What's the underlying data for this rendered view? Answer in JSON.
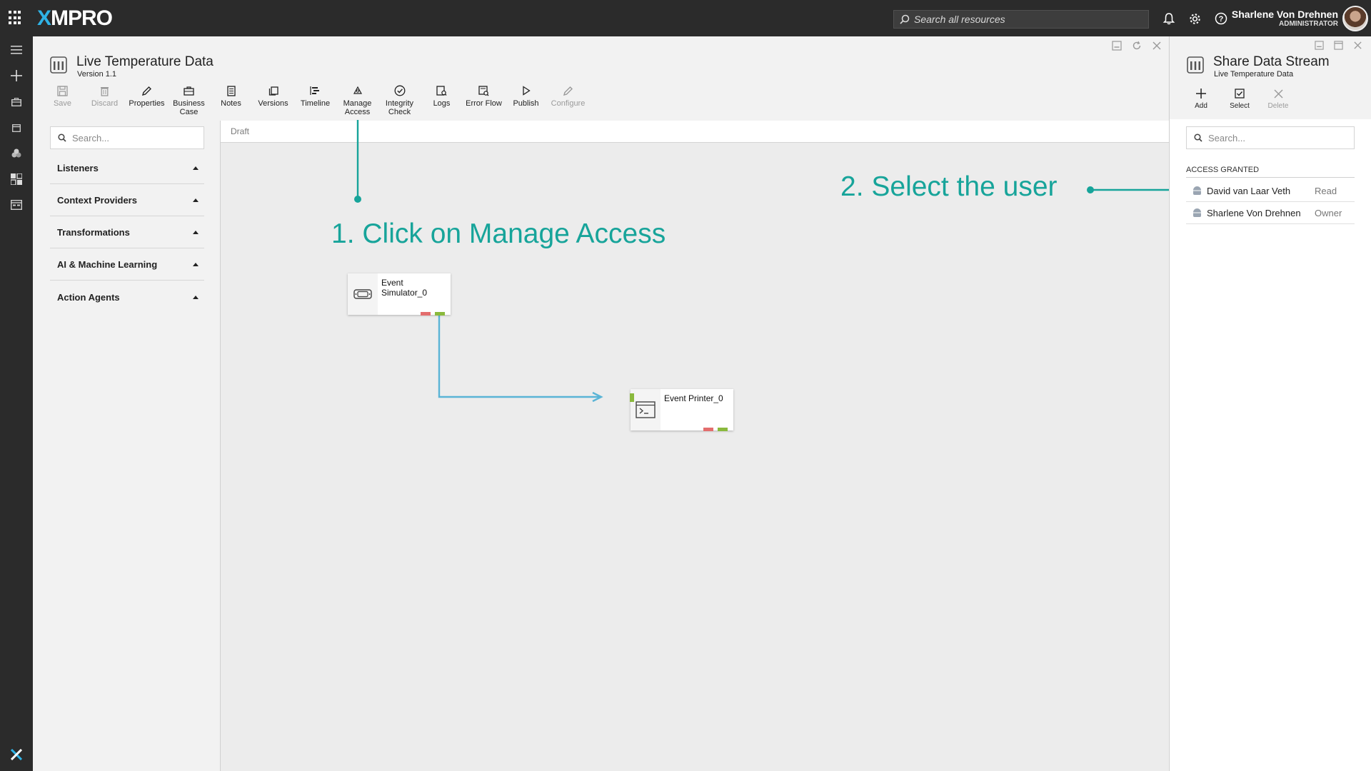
{
  "app": {
    "logo_prefix": "X",
    "logo_rest": "MPRO",
    "search_placeholder": "Search all resources",
    "user_name": "Sharlene Von Drehnen",
    "user_role": "ADMINISTRATOR"
  },
  "stream": {
    "title": "Live Temperature Data",
    "version": "Version 1.1",
    "status_tab": "Draft"
  },
  "toolbar": [
    {
      "label": "Save",
      "icon": "save-icon",
      "enabled": false
    },
    {
      "label": "Discard",
      "icon": "trash-icon",
      "enabled": false
    },
    {
      "label": "Properties",
      "icon": "pencil-icon",
      "enabled": true
    },
    {
      "label": "Business Case",
      "icon": "briefcase-icon",
      "enabled": true
    },
    {
      "label": "Notes",
      "icon": "notes-icon",
      "enabled": true
    },
    {
      "label": "Versions",
      "icon": "versions-icon",
      "enabled": true
    },
    {
      "label": "Timeline",
      "icon": "timeline-icon",
      "enabled": true
    },
    {
      "label": "Manage Access",
      "icon": "access-icon",
      "enabled": true
    },
    {
      "label": "Integrity Check",
      "icon": "check-circle-icon",
      "enabled": true
    },
    {
      "label": "Logs",
      "icon": "logs-icon",
      "enabled": true
    },
    {
      "label": "Error Flow",
      "icon": "error-flow-icon",
      "enabled": true
    },
    {
      "label": "Publish",
      "icon": "play-icon",
      "enabled": true
    },
    {
      "label": "Configure",
      "icon": "pencil-icon",
      "enabled": false
    }
  ],
  "sidebar": {
    "search_placeholder": "Search...",
    "categories": [
      "Listeners",
      "Context Providers",
      "Transformations",
      "AI & Machine Learning",
      "Action Agents"
    ]
  },
  "canvas": {
    "nodes": [
      {
        "label": "Event Simulator_0",
        "icon": "simulator-icon"
      },
      {
        "label": "Event Printer_0",
        "icon": "terminal-icon"
      }
    ]
  },
  "annotations": {
    "step1": "1. Click on Manage Access",
    "step2": "2. Select the user",
    "color": "#17a49a"
  },
  "share_panel": {
    "title": "Share Data Stream",
    "subtitle": "Live Temperature Data",
    "tools": [
      {
        "label": "Add",
        "icon": "plus-icon",
        "enabled": true
      },
      {
        "label": "Select",
        "icon": "checkbox-icon",
        "enabled": true
      },
      {
        "label": "Delete",
        "icon": "close-icon",
        "enabled": false
      }
    ],
    "search_placeholder": "Search...",
    "section_label": "ACCESS GRANTED",
    "users": [
      {
        "name": "David van Laar Veth",
        "role": "Read"
      },
      {
        "name": "Sharlene Von Drehnen",
        "role": "Owner"
      }
    ]
  }
}
